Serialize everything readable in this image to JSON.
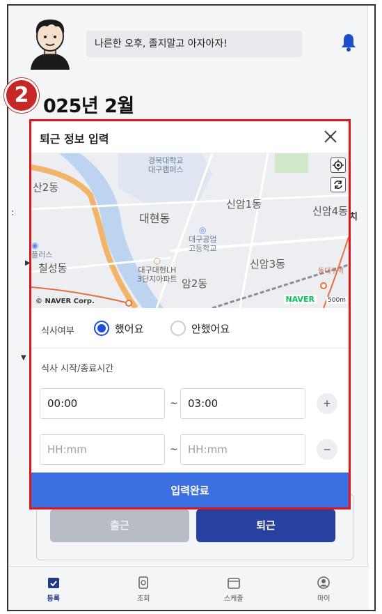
{
  "header": {
    "greeting": "나른한 오후, 졸지말고 아자아자!"
  },
  "calendar": {
    "month_title": "025년 2월",
    "step_badge": "2"
  },
  "background": {
    "checkin_label": "출근",
    "checkout_label": "퇴근",
    "frag_left_1": "산2동",
    "frag_right_1": "치"
  },
  "modal": {
    "title": "퇴근 정보 입력",
    "map": {
      "labels": {
        "campus": "경북대학교\n대구캠퍼스",
        "san2": "산2동",
        "daehyeon": "대현동",
        "sinam1": "신암1동",
        "sinam4": "신암4동",
        "school": "대구공업\n고등학교",
        "plus": "플러스",
        "chilseong": "칠성동",
        "lh": "대구대현LH\n3단지아파트",
        "sinam2": "암2동",
        "sinam3": "신암3동",
        "dongdaegu": "동대구역"
      },
      "attribution": "© NAVER Corp.",
      "logo": "NAVER",
      "scale": "500m"
    },
    "meal": {
      "label": "식사여부",
      "option_yes": "했어요",
      "option_no": "안했어요",
      "selected": "했어요"
    },
    "time": {
      "label": "식사 시작/종료시간",
      "rows": [
        {
          "start": "00:00",
          "end": "03:00",
          "start_placeholder": "HH:mm",
          "end_placeholder": "HH:mm",
          "action": "+"
        },
        {
          "start": "",
          "end": "",
          "start_placeholder": "HH:mm",
          "end_placeholder": "HH:mm",
          "action": "−"
        }
      ],
      "separator": "~"
    },
    "submit_label": "입력완료"
  },
  "nav": {
    "items": [
      {
        "label": "등록",
        "icon": "check-calendar-icon",
        "active": true
      },
      {
        "label": "조회",
        "icon": "document-search-icon",
        "active": false
      },
      {
        "label": "스케줄",
        "icon": "calendar-icon",
        "active": false
      },
      {
        "label": "마이",
        "icon": "user-icon",
        "active": false
      }
    ]
  },
  "colors": {
    "accent": "#1d4ed8",
    "submit": "#3b6fe0",
    "highlight_border": "#e0141b",
    "checkout_button": "#27419e"
  }
}
